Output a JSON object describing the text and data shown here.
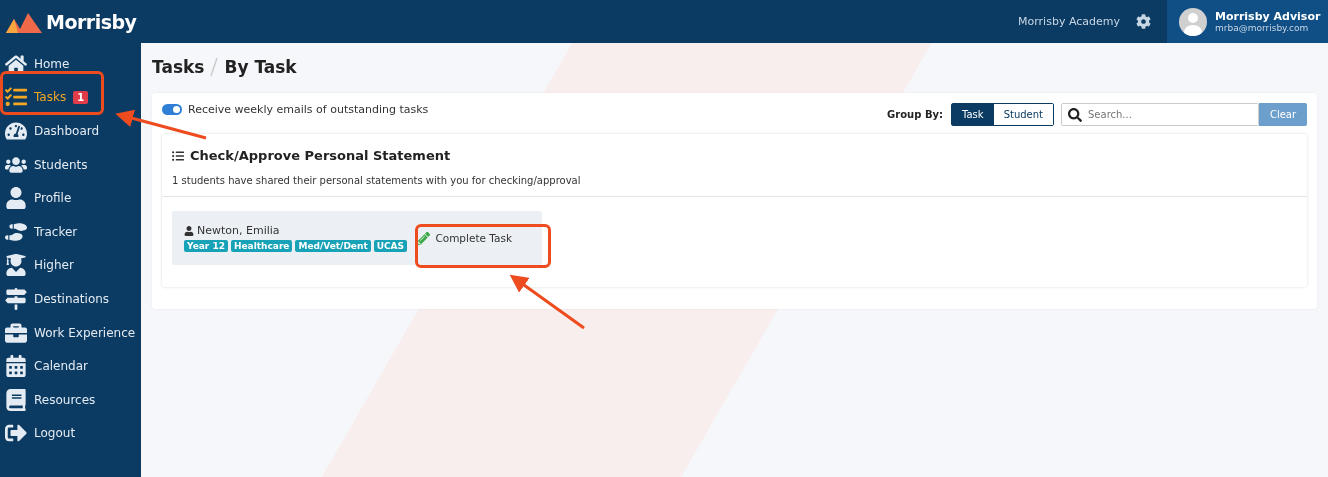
{
  "brand": {
    "name": "Morrisby"
  },
  "topbar": {
    "school": "Morrisby Academy",
    "user": {
      "name": "Morrisby Advisor",
      "email": "mrba@morrisby.com"
    }
  },
  "sidebar": {
    "items": [
      {
        "kind": "home",
        "label": "Home",
        "selected": false
      },
      {
        "kind": "tasks",
        "label": "Tasks",
        "selected": true,
        "badge": "1"
      },
      {
        "kind": "dashboard",
        "label": "Dashboard",
        "selected": false
      },
      {
        "kind": "students",
        "label": "Students",
        "selected": false
      },
      {
        "kind": "profile",
        "label": "Profile",
        "selected": false
      },
      {
        "kind": "tracker",
        "label": "Tracker",
        "selected": false
      },
      {
        "kind": "higher",
        "label": "Higher",
        "selected": false
      },
      {
        "kind": "destinations",
        "label": "Destinations",
        "selected": false
      },
      {
        "kind": "work",
        "label": "Work Experience",
        "selected": false
      },
      {
        "kind": "calendar",
        "label": "Calendar",
        "selected": false
      },
      {
        "kind": "resources",
        "label": "Resources",
        "selected": false
      },
      {
        "kind": "logout",
        "label": "Logout",
        "selected": false
      }
    ]
  },
  "breadcrumb": [
    "Tasks",
    "By Task"
  ],
  "email_toggle": {
    "label": "Receive weekly emails of outstanding tasks",
    "on": true
  },
  "group_by": {
    "label": "Group By:",
    "options": [
      {
        "label": "Task",
        "selected": true
      },
      {
        "label": "Student",
        "selected": false
      }
    ]
  },
  "search": {
    "placeholder": "Search...",
    "button": "Clear"
  },
  "task_group": {
    "title": "Check/Approve Personal Statement",
    "description": "1 students have shared their personal statements with you for checking/approval",
    "students": [
      {
        "name": "Newton, Emilia",
        "tags": [
          "Year 12",
          "Healthcare",
          "Med/Vet/Dent",
          "UCAS"
        ],
        "action": "Complete Task"
      }
    ]
  }
}
